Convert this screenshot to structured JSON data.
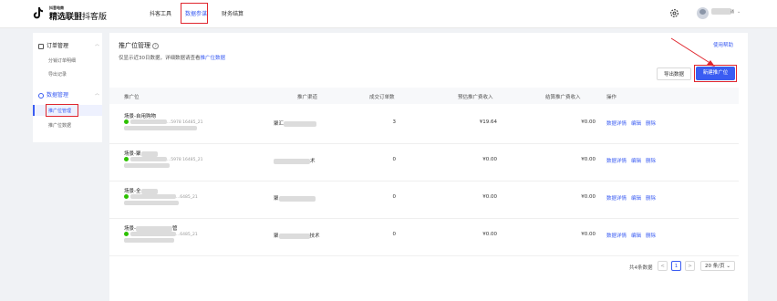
{
  "header": {
    "brand_small": "抖音电商",
    "brand_main": "精选联盟",
    "brand_sub": "抖客版",
    "nav": [
      "抖客工具",
      "数据参谋",
      "财务结算"
    ],
    "active_nav": "数据参谋",
    "user_suffix": "通"
  },
  "sidebar": {
    "groups": [
      {
        "label": "订单管理",
        "items": [
          "分销订单明细",
          "导出记录"
        ]
      },
      {
        "label": "数据管理",
        "items": [
          "推广位管理",
          "推广位数据"
        ]
      }
    ],
    "active_item": "推广位管理"
  },
  "page": {
    "title": "推广位管理",
    "subtitle": "仅显示近30日数据，详细数据请查看",
    "subtitle_link": "推广位数据",
    "usage_help": "使用帮助",
    "export_btn": "导出数据",
    "new_btn": "新建推广位"
  },
  "table": {
    "columns": [
      "推广位",
      "推广渠道",
      "成交订单数",
      "预估推广费收入",
      "结算推广费收入",
      "操作"
    ],
    "rows": [
      {
        "name": "场景-自用购物",
        "id_tail": "...5978 16485_21",
        "channel_prefix": "聚汇",
        "orders": "3",
        "estimated": "¥19.64",
        "settled": "¥0.00"
      },
      {
        "name": "场景-聚",
        "id_tail": "...5978 16485_21",
        "channel_prefix": "",
        "channel_suffix": "术",
        "orders": "0",
        "estimated": "¥0.00",
        "settled": "¥0.00"
      },
      {
        "name": "场景-全",
        "id_tail": "...6485_21",
        "channel_prefix": "聚",
        "orders": "0",
        "estimated": "¥0.00",
        "settled": "¥0.00"
      },
      {
        "name": "场景-",
        "name_tail": "管",
        "id_tail": "...6485_21",
        "channel_prefix": "聚",
        "channel_suffix": "技术",
        "orders": "0",
        "estimated": "¥0.00",
        "settled": "¥0.00"
      }
    ],
    "ops": [
      "数据详情",
      "编辑",
      "删除"
    ]
  },
  "pagination": {
    "total": "共4条数据",
    "prev": "<",
    "current": "1",
    "next": ">",
    "page_size": "20 条/页"
  },
  "colors": {
    "accent": "#3a5cf2",
    "highlight_box": "#e0262e"
  }
}
